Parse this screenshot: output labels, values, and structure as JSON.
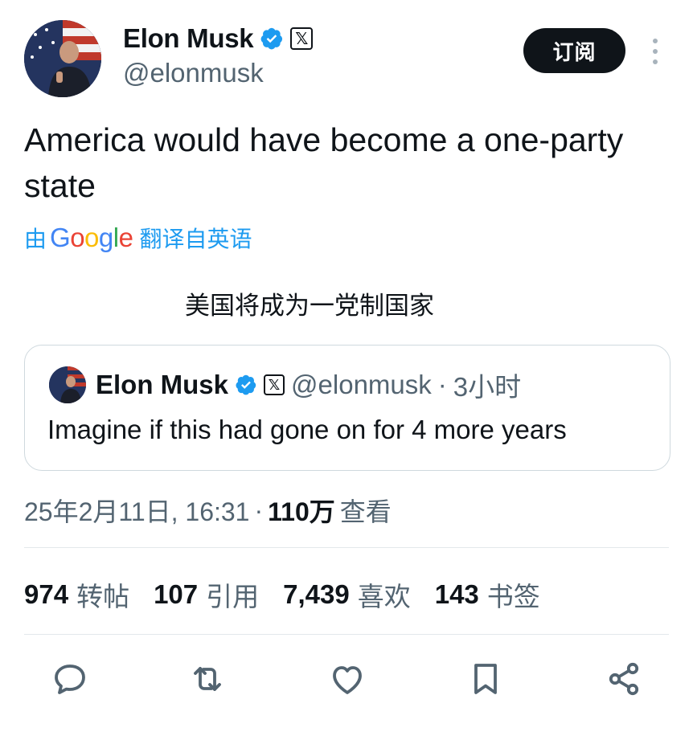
{
  "header": {
    "name": "Elon Musk",
    "handle": "@elonmusk",
    "subscribe_label": "订阅",
    "icons": [
      "avatar",
      "verified-badge-icon",
      "x-logo-icon",
      "more-options-icon"
    ]
  },
  "tweet": {
    "text": "America would have become a one-party state",
    "translate_prefix": "由",
    "translate_google": "Google",
    "translate_suffix": "翻译自英语",
    "translated_text": "美国将成为一党制国家"
  },
  "quote": {
    "name": "Elon Musk",
    "handle": "@elonmusk",
    "separator": "·",
    "time": "3小时",
    "text": "Imagine if this had gone on for 4 more years"
  },
  "meta": {
    "timestamp": "25年2月11日, 16:31",
    "separator": "·",
    "views": "110万",
    "views_label": "查看"
  },
  "stats": [
    {
      "num": "974",
      "label": "转帖"
    },
    {
      "num": "107",
      "label": "引用"
    },
    {
      "num": "7,439",
      "label": "喜欢"
    },
    {
      "num": "143",
      "label": "书签"
    }
  ],
  "actions": [
    "reply-icon",
    "retweet-icon",
    "like-icon",
    "bookmark-icon",
    "share-icon"
  ],
  "colors": {
    "text": "#0f1419",
    "secondary": "#536471",
    "accent_blue": "#1d9bf0",
    "button_bg": "#0f1419",
    "border": "#cfd9de"
  }
}
